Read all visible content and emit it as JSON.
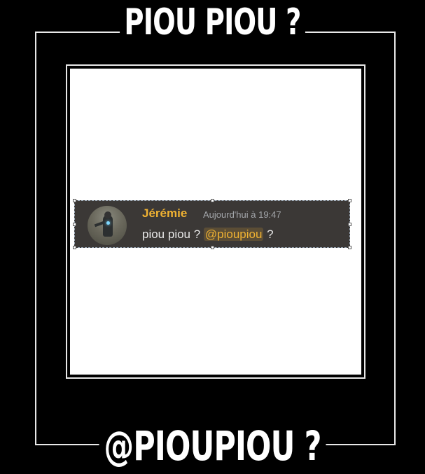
{
  "meme": {
    "top_text": "PIOU PIOU ?",
    "bottom_text": "@PIOUPIOU ?"
  },
  "message": {
    "username": "Jérémie",
    "timestamp": "Aujourd'hui à 19:47",
    "text_before": "piou piou ? ",
    "mention": "@pioupiou",
    "text_after": " ?",
    "avatar_icon": "robot-avatar-icon"
  },
  "colors": {
    "background": "#000000",
    "frame": "#e8e8e8",
    "panel": "#ffffff",
    "card": "#3b3836",
    "username": "#f0b232",
    "mention": "#f0b232",
    "timestamp": "#a3a6aa",
    "text": "#e8e8e8"
  }
}
